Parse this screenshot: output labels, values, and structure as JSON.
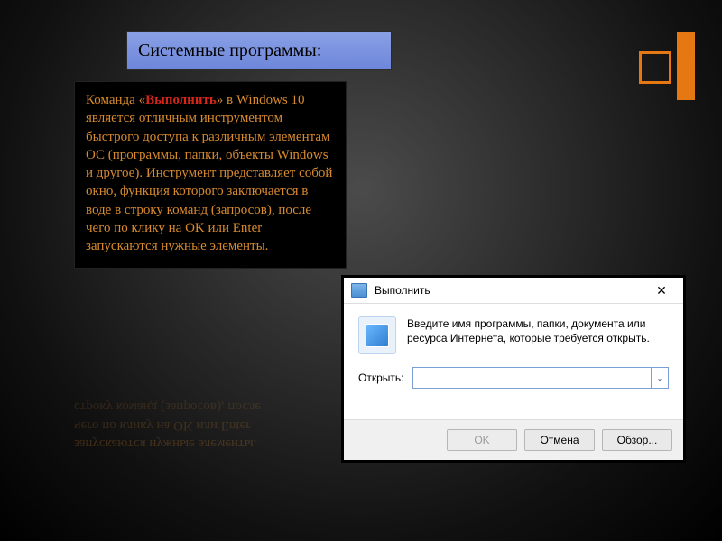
{
  "slide": {
    "title": "Системные программы:"
  },
  "info": {
    "pre": "Команда «",
    "highlight": "Выполнить",
    "post": "» в Windows 10 является отличным инструментом быстрого доступа к различным элементам ОС (программы, папки, объекты Windows и другое). Инструмент представляет собой окно, функция которого заключается в воде в строку команд (запросов), после чего по клику на OK или Enter запускаются нужные элементы."
  },
  "reflection": {
    "line1": "запускаются нужные элементы.",
    "line2": "чего по клику на OK или Enter",
    "line3": "строку команд (запросов), после"
  },
  "run_dialog": {
    "title": "Выполнить",
    "close": "✕",
    "instruction": "Введите имя программы, папки, документа или ресурса Интернета, которые требуется открыть.",
    "open_label": "Открыть:",
    "input_value": "",
    "dropdown_glyph": "⌄",
    "buttons": {
      "ok": "OK",
      "cancel": "Отмена",
      "browse": "Обзор..."
    }
  }
}
